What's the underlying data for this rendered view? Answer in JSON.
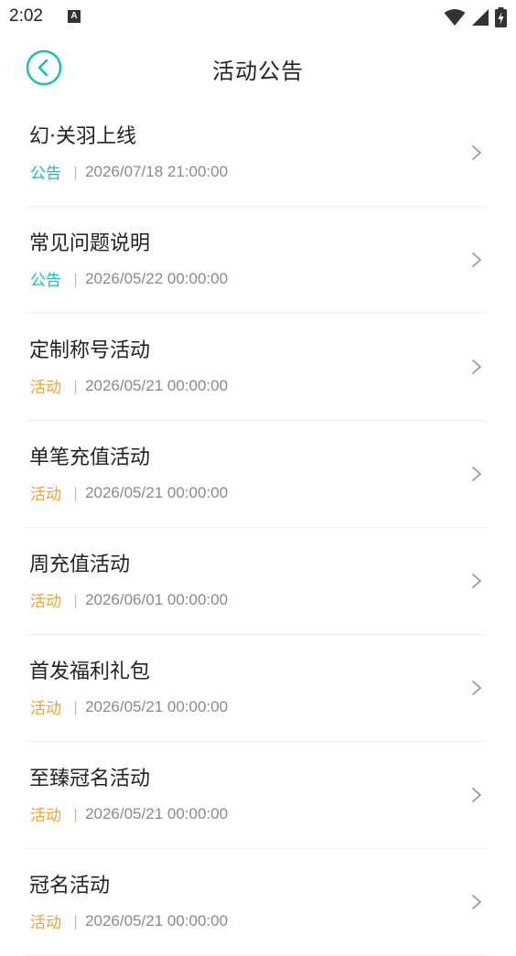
{
  "status_bar": {
    "time": "2:02",
    "notification_icon": "A"
  },
  "header": {
    "title": "活动公告",
    "back_icon": "chevron-left-circle-icon"
  },
  "colors": {
    "accent_teal": "#1bbfae",
    "tag_announcement": "#1bbfae",
    "tag_event": "#f2a12e"
  },
  "items": [
    {
      "title": "幻·关羽上线",
      "tag": "公告",
      "tag_type": "announcement",
      "date": "2026/07/18 21:00:00"
    },
    {
      "title": "常见问题说明",
      "tag": "公告",
      "tag_type": "announcement",
      "date": "2026/05/22 00:00:00"
    },
    {
      "title": "定制称号活动",
      "tag": "活动",
      "tag_type": "event",
      "date": "2026/05/21 00:00:00"
    },
    {
      "title": "单笔充值活动",
      "tag": "活动",
      "tag_type": "event",
      "date": "2026/05/21 00:00:00"
    },
    {
      "title": "周充值活动",
      "tag": "活动",
      "tag_type": "event",
      "date": "2026/06/01 00:00:00"
    },
    {
      "title": "首发福利礼包",
      "tag": "活动",
      "tag_type": "event",
      "date": "2026/05/21 00:00:00"
    },
    {
      "title": "至臻冠名活动",
      "tag": "活动",
      "tag_type": "event",
      "date": "2026/05/21 00:00:00"
    },
    {
      "title": "冠名活动",
      "tag": "活动",
      "tag_type": "event",
      "date": "2026/05/21 00:00:00"
    }
  ]
}
